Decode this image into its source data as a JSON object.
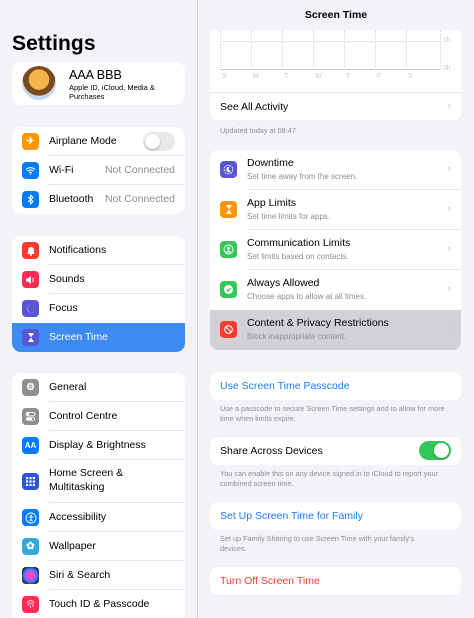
{
  "sidebar": {
    "title": "Settings",
    "profile": {
      "name": "AAA BBB",
      "subtitle": "Apple ID, iCloud, Media & Purchases"
    },
    "connectivity": [
      {
        "label": "Airplane Mode",
        "icon": "airplane-icon",
        "color": "#ff9500",
        "toggle": false
      },
      {
        "label": "Wi-Fi",
        "icon": "wifi-icon",
        "color": "#007aff",
        "value": "Not Connected"
      },
      {
        "label": "Bluetooth",
        "icon": "bluetooth-icon",
        "color": "#007aff",
        "value": "Not Connected"
      }
    ],
    "notifications": [
      {
        "label": "Notifications",
        "icon": "bell-icon",
        "color": "#ff3b30"
      },
      {
        "label": "Sounds",
        "icon": "speaker-icon",
        "color": "#ff2d55"
      },
      {
        "label": "Focus",
        "icon": "moon-icon",
        "color": "#5856d6"
      },
      {
        "label": "Screen Time",
        "icon": "hourglass-icon",
        "color": "#5856d6",
        "selected": true
      }
    ],
    "general": [
      {
        "label": "General",
        "icon": "gear-icon",
        "color": "#8e8e93"
      },
      {
        "label": "Control Centre",
        "icon": "switches-icon",
        "color": "#8e8e93"
      },
      {
        "label": "Display & Brightness",
        "icon": "aa-icon",
        "color": "#007aff"
      },
      {
        "label": "Home Screen &",
        "label2": "Multitasking",
        "icon": "grid-icon",
        "color": "#2c54d6"
      },
      {
        "label": "Accessibility",
        "icon": "accessibility-icon",
        "color": "#007aff"
      },
      {
        "label": "Wallpaper",
        "icon": "flower-icon",
        "color": "#34aadc"
      },
      {
        "label": "Siri & Search",
        "icon": "siri-icon",
        "color": "#222222"
      },
      {
        "label": "Touch ID & Passcode",
        "icon": "fingerprint-icon",
        "color": "#ff2d55"
      }
    ]
  },
  "detail": {
    "title": "Screen Time",
    "chart": {
      "days": [
        "S",
        "M",
        "T",
        "W",
        "T",
        "F",
        "S"
      ],
      "y_labels": [
        "1h",
        "0h"
      ],
      "see_all": "See All Activity",
      "updated": "Updated today at 08:47"
    },
    "items": [
      {
        "label": "Downtime",
        "sub": "Set time away from the screen.",
        "icon": "downtime-icon",
        "color": "#5856d6"
      },
      {
        "label": "App Limits",
        "sub": "Set time limits for apps.",
        "icon": "hourglass-icon",
        "color": "#ff9500"
      },
      {
        "label": "Communication Limits",
        "sub": "Set limits based on contacts.",
        "icon": "person-icon",
        "color": "#34c759"
      },
      {
        "label": "Always Allowed",
        "sub": "Choose apps to allow at all times.",
        "icon": "check-icon",
        "color": "#34c759"
      },
      {
        "label": "Content & Privacy Restrictions",
        "sub": "Block inappropriate content.",
        "icon": "restrict-icon",
        "color": "#ff3b30",
        "highlight": true
      }
    ],
    "passcode": {
      "label": "Use Screen Time Passcode",
      "note": "Use a passcode to secure Screen Time settings and to allow for more time when limits expire."
    },
    "share": {
      "label": "Share Across Devices",
      "toggle": true,
      "note": "You can enable this on any device signed in to iCloud to report your combined screen time."
    },
    "family": {
      "label": "Set Up Screen Time for Family",
      "note": "Set up Family Sharing to use Screen Time with your family's devices."
    },
    "turn_off": {
      "label": "Turn Off Screen Time"
    }
  }
}
